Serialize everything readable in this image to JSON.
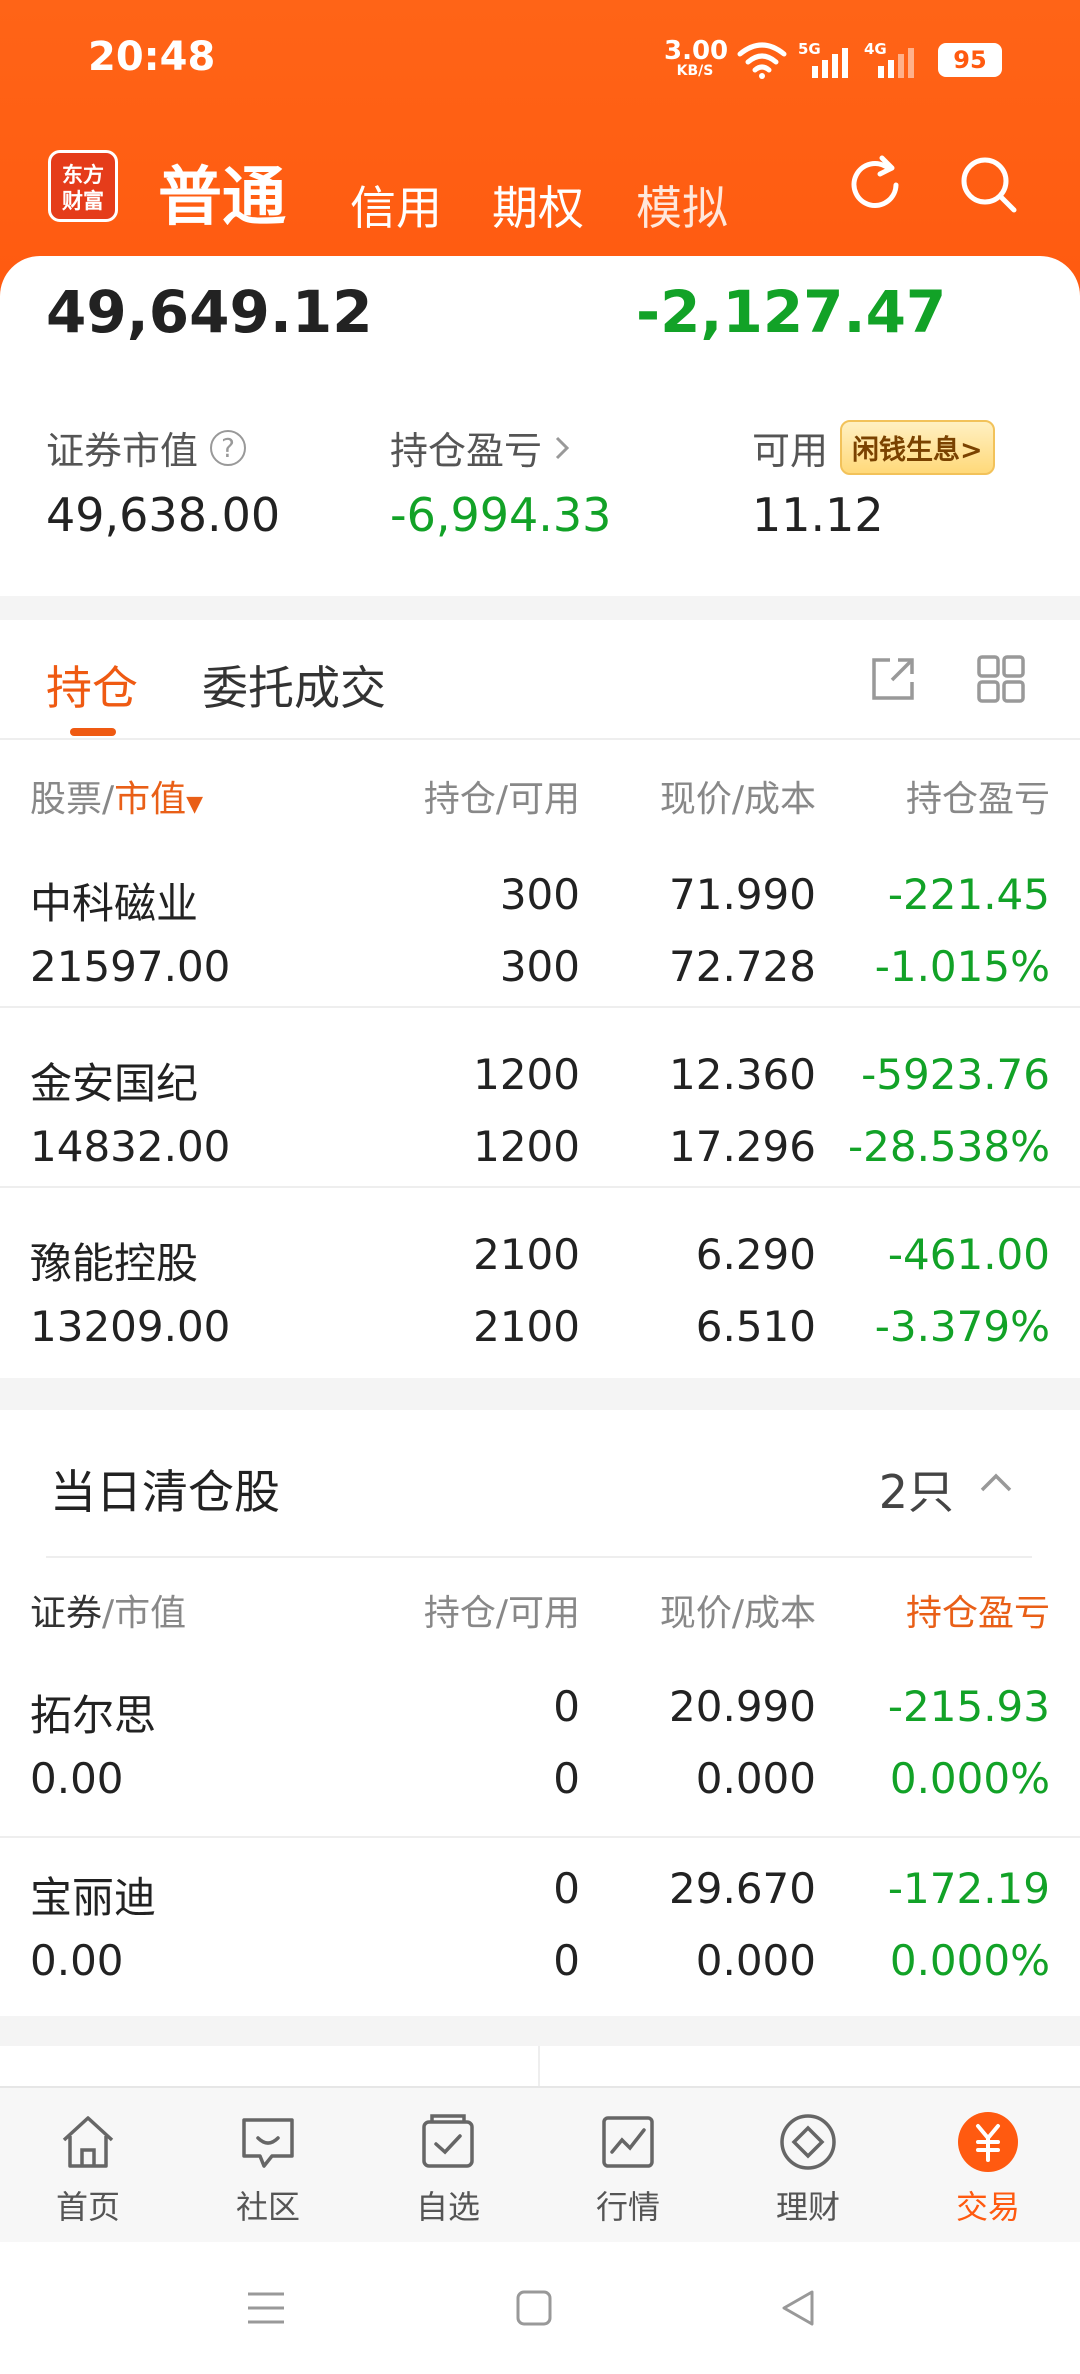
{
  "status": {
    "time": "20:48",
    "net_speed": "3.00",
    "net_unit": "KB/S",
    "sig1": "5G",
    "sig2": "4G",
    "battery": "95"
  },
  "header": {
    "logo_line1": "东方",
    "logo_line2": "财富",
    "tabs": [
      "普通",
      "信用",
      "期权",
      "模拟"
    ]
  },
  "account": {
    "total_assets": "49,649.12",
    "day_pl": "-2,127.47",
    "market_value_label": "证券市值",
    "market_value": "49,638.00",
    "position_pl_label": "持仓盈亏",
    "position_pl": "-6,994.33",
    "available_label": "可用",
    "available": "11.12",
    "badge": "闲钱生息>"
  },
  "tabs": {
    "positions": "持仓",
    "orders": "委托成交"
  },
  "positions": {
    "header": {
      "c1a": "股票/",
      "c1b": "市值",
      "c2": "持仓/可用",
      "c3": "现价/成本",
      "c4": "持仓盈亏"
    },
    "rows": [
      {
        "name": "中科磁业",
        "mv": "21597.00",
        "qty": "300",
        "avail": "300",
        "price": "71.990",
        "cost": "72.728",
        "pl": "-221.45",
        "pl_pct": "-1.015%"
      },
      {
        "name": "金安国纪",
        "mv": "14832.00",
        "qty": "1200",
        "avail": "1200",
        "price": "12.360",
        "cost": "17.296",
        "pl": "-5923.76",
        "pl_pct": "-28.538%"
      },
      {
        "name": "豫能控股",
        "mv": "13209.00",
        "qty": "2100",
        "avail": "2100",
        "price": "6.290",
        "cost": "6.510",
        "pl": "-461.00",
        "pl_pct": "-3.379%"
      }
    ]
  },
  "cleared": {
    "title": "当日清仓股",
    "count": "2只",
    "header": {
      "c1a": "证券",
      "c1b": "/市值",
      "c2": "持仓/可用",
      "c3": "现价/成本",
      "c4": "持仓盈亏"
    },
    "rows": [
      {
        "name": "拓尔思",
        "mv": "0.00",
        "qty": "0",
        "avail": "0",
        "price": "20.990",
        "cost": "0.000",
        "pl": "-215.93",
        "pl_pct": "0.000%"
      },
      {
        "name": "宝丽迪",
        "mv": "0.00",
        "qty": "0",
        "avail": "0",
        "price": "29.670",
        "cost": "0.000",
        "pl": "-172.19",
        "pl_pct": "0.000%"
      }
    ]
  },
  "nav": {
    "items": [
      "首页",
      "社区",
      "自选",
      "行情",
      "理财",
      "交易"
    ],
    "active": "交易"
  },
  "colors": {
    "brand_orange": "#ff5a10",
    "gain_green": "#12a227"
  },
  "icons": {
    "refresh": "refresh-icon",
    "search": "search-icon",
    "export": "export-icon",
    "grid": "grid-icon"
  }
}
